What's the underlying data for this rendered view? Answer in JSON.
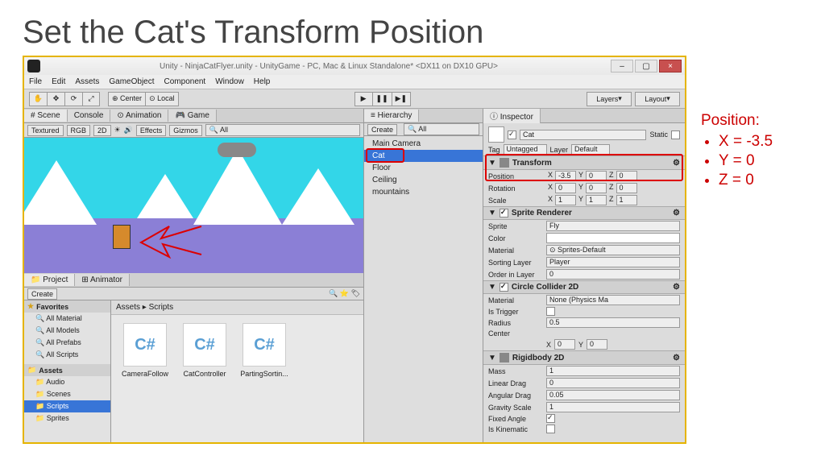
{
  "slide_title": "Set the Cat's Transform Position",
  "win": {
    "title": "Unity - NinjaCatFlyer.unity - UnityGame - PC, Mac & Linux Standalone* <DX11 on DX10 GPU>",
    "min": "–",
    "max": "▢",
    "close": "×"
  },
  "menu": [
    "File",
    "Edit",
    "Assets",
    "GameObject",
    "Component",
    "Window",
    "Help"
  ],
  "toolbar": {
    "hand": "✋",
    "move": "✥",
    "rotate": "⟳",
    "scale": "⤢",
    "center": "⊕ Center",
    "local": "⊙ Local",
    "play": "▶",
    "pause": "❚❚",
    "step": "▶❚",
    "layers": "Layers",
    "layout": "Layout"
  },
  "scene_tabs": [
    "# Scene",
    "Console",
    "Animation",
    "Game"
  ],
  "scenebar": {
    "shaded": "Textured",
    "rgb": "RGB",
    "twod": "2D",
    "effects": "Effects",
    "gizmos": "Gizmos",
    "search": "All"
  },
  "proj_tabs": [
    "Project",
    "Animator"
  ],
  "create": "Create",
  "favorites": {
    "label": "Favorites",
    "items": [
      "All Material",
      "All Models",
      "All Prefabs",
      "All Scripts"
    ]
  },
  "assets": {
    "label": "Assets",
    "items": [
      "Audio",
      "Scenes",
      "Scripts",
      "Sprites"
    ],
    "selected": "Scripts"
  },
  "breadcrumb": "Assets ▸ Scripts",
  "files": [
    "CameraFollow",
    "CatController",
    "PartingSortin..."
  ],
  "hierarchy": {
    "tab": "Hierarchy",
    "create": "Create",
    "search": "All",
    "items": [
      "Main Camera",
      "Cat",
      "Floor",
      "Ceiling",
      "mountains"
    ],
    "selected": "Cat"
  },
  "inspector": {
    "tab": "Inspector",
    "name": "Cat",
    "static": "Static",
    "tag_lbl": "Tag",
    "tag": "Untagged",
    "layer_lbl": "Layer",
    "layer": "Default",
    "transform": {
      "title": "Transform",
      "position": {
        "lbl": "Position",
        "x": "-3.5",
        "y": "0",
        "z": "0"
      },
      "rotation": {
        "lbl": "Rotation",
        "x": "0",
        "y": "0",
        "z": "0"
      },
      "scale": {
        "lbl": "Scale",
        "x": "1",
        "y": "1",
        "z": "1"
      }
    },
    "sprite": {
      "title": "Sprite Renderer",
      "sprite_lbl": "Sprite",
      "sprite": "Fly",
      "color_lbl": "Color",
      "material_lbl": "Material",
      "material": "Sprites-Default",
      "sorting_lbl": "Sorting Layer",
      "sorting": "Player",
      "order_lbl": "Order in Layer",
      "order": "0"
    },
    "collider": {
      "title": "Circle Collider 2D",
      "material_lbl": "Material",
      "material": "None (Physics Ma",
      "trigger_lbl": "Is Trigger",
      "radius_lbl": "Radius",
      "radius": "0.5",
      "center_lbl": "Center",
      "cx": "0",
      "cy": "0"
    },
    "rigid": {
      "title": "Rigidbody 2D",
      "mass_lbl": "Mass",
      "mass": "1",
      "lindrag_lbl": "Linear Drag",
      "lindrag": "0",
      "angdrag_lbl": "Angular Drag",
      "angdrag": "0.05",
      "grav_lbl": "Gravity Scale",
      "grav": "1",
      "fixed_lbl": "Fixed Angle",
      "kin_lbl": "Is Kinematic"
    }
  },
  "notes": {
    "title": "Position:",
    "items": [
      "X = -3.5",
      "Y = 0",
      "Z = 0"
    ]
  }
}
